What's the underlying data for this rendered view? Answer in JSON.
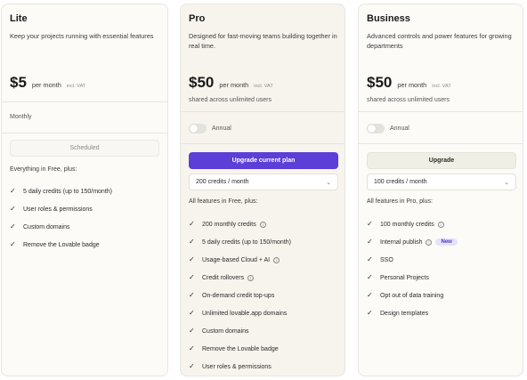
{
  "plans": {
    "lite": {
      "name": "Lite",
      "description": "Keep your projects running with essential features",
      "price": "$5",
      "period": "per month",
      "vat": "incl. VAT",
      "billing": "Monthly",
      "button": "Scheduled",
      "features_title": "Everything in Free, plus:",
      "features": [
        "5 daily credits (up to 150/month)",
        "User roles & permissions",
        "Custom domains",
        "Remove the Lovable badge"
      ]
    },
    "pro": {
      "name": "Pro",
      "description": "Designed for fast-moving teams building together in real time.",
      "price": "$50",
      "period": "per month",
      "vat": "incl. VAT",
      "note": "shared across unlimited users",
      "toggle_label": "Annual",
      "button": "Upgrade current plan",
      "select_value": "200 credits / month",
      "features_title": "All features in Free, plus:",
      "features": [
        "200 monthly credits",
        "5 daily credits (up to 150/month)",
        "Usage-based Cloud + AI",
        "Credit rollovers",
        "On-demand credit top-ups",
        "Unlimited lovable.app domains",
        "Custom domains",
        "Remove the Lovable badge",
        "User roles & permissions"
      ]
    },
    "business": {
      "name": "Business",
      "description": "Advanced controls and power features for growing departments",
      "price": "$50",
      "period": "per month",
      "vat": "incl. VAT",
      "note": "shared across unlimited users",
      "toggle_label": "Annual",
      "button": "Upgrade",
      "select_value": "100 credits / month",
      "features_title": "All features in Pro, plus:",
      "features": [
        "100 monthly credits",
        "Internal publish",
        "SSO",
        "Personal Projects",
        "Opt out of data training",
        "Design templates"
      ],
      "badge": "New"
    }
  },
  "icons": {
    "check": "check-icon",
    "info": "info-icon",
    "chevron": "chevron-down-icon"
  },
  "colors": {
    "accent": "#5b3fd6",
    "badge_bg": "#e6e1ff",
    "card_bg": "#fcfbf8",
    "pro_bg": "#f7f4ee"
  }
}
